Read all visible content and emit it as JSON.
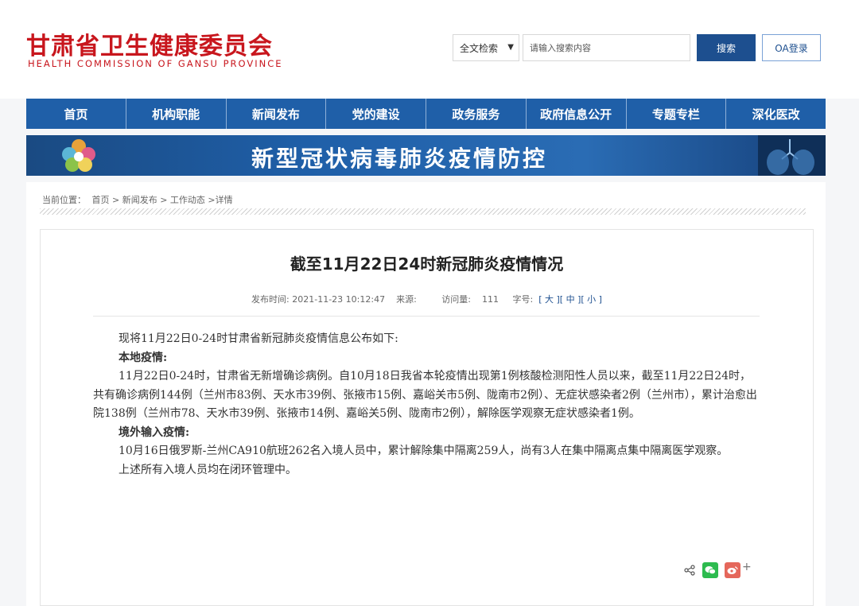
{
  "header": {
    "logo_cn": "甘肃省卫生健康委员会",
    "logo_en": "HEALTH  COMMISSION  OF  GANSU  PROVINCE",
    "search_select": "全文检索",
    "search_placeholder": "请输入搜索内容",
    "search_button": "搜索",
    "oa_button": "OA登录"
  },
  "nav": {
    "items": [
      "首页",
      "机构职能",
      "新闻发布",
      "党的建设",
      "政务服务",
      "政府信息公开",
      "专题专栏",
      "深化医改"
    ]
  },
  "banner": {
    "text": "新型冠状病毒肺炎疫情防控"
  },
  "breadcrumb": {
    "prefix": "当前位置：",
    "path": "首页 > 新闻发布 > 工作动态 >详情"
  },
  "article": {
    "title": "截至11月22日24时新冠肺炎疫情情况",
    "meta": {
      "publish_label": "发布时间:",
      "publish_time": "2021-11-23 10:12:47",
      "source_label": "来源:",
      "views_label": "访问量:",
      "views": "111",
      "font_label": "字号:",
      "size_large": "大",
      "size_medium": "中",
      "size_small": "小"
    },
    "intro": "现将11月22日0-24时甘肃省新冠肺炎疫情信息公布如下:",
    "local_heading": "本地疫情:",
    "local_text": "11月22日0-24时，甘肃省无新增确诊病例。自10月18日我省本轮疫情出现第1例核酸检测阳性人员以来，截至11月22日24时，共有确诊病例144例（兰州市83例、天水市39例、张掖市15例、嘉峪关市5例、陇南市2例）、无症状感染者2例（兰州市），累计治愈出院138例（兰州市78、天水市39例、张掖市14例、嘉峪关5例、陇南市2例），解除医学观察无症状感染者1例。",
    "overseas_heading": "境外输入疫情:",
    "overseas_text": "10月16日俄罗斯-兰州CA910航班262名入境人员中，累计解除集中隔离259人，尚有3人在集中隔离点集中隔离医学观察。",
    "closing_text": "上述所有入境人员均在闭环管理中。"
  },
  "share": {
    "plus": "+"
  }
}
